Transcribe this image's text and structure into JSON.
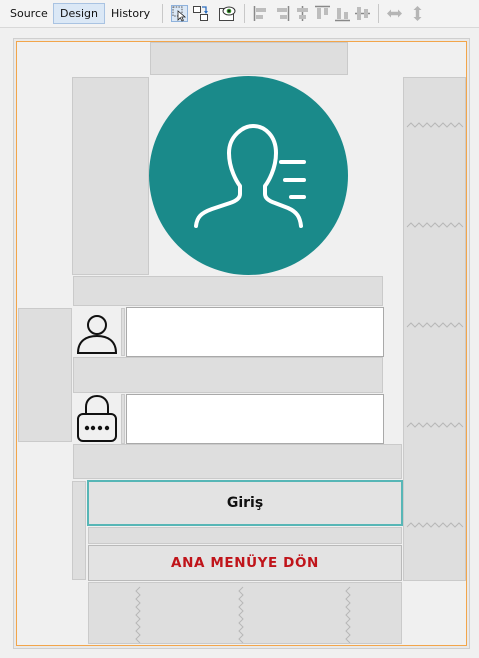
{
  "toolbar": {
    "tabs": [
      {
        "label": "Source",
        "active": false
      },
      {
        "label": "Design",
        "active": true
      },
      {
        "label": "History",
        "active": false
      }
    ],
    "icons": [
      "selection-mode-icon",
      "connection-mode-icon",
      "preview-design-icon",
      "align-left-icon",
      "align-right-icon",
      "center-horizontally-icon",
      "align-top-icon",
      "align-bottom-icon",
      "center-vertically-icon",
      "resize-horizontally-icon",
      "resize-vertically-icon"
    ]
  },
  "form": {
    "login_button": "Giriş",
    "main_menu_button": "ANA MENÜYE DÖN",
    "username_value": "",
    "password_value": ""
  },
  "colors": {
    "avatar_bg": "#1a8a8a",
    "frame_border": "#f2a54a",
    "menu_text": "#c0141a",
    "login_border": "#57b6b6"
  }
}
